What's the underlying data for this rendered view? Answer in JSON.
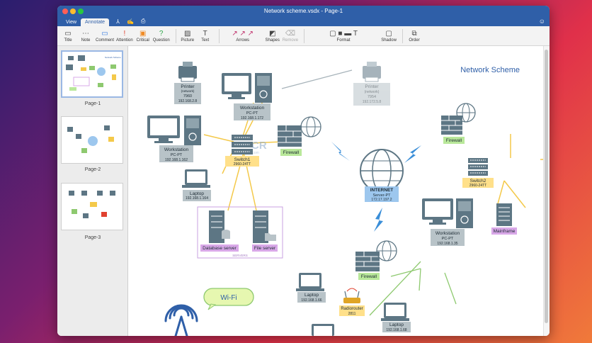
{
  "window": {
    "title": "Network scheme.vsdx - Page-1"
  },
  "tabs": [
    {
      "label": "View",
      "active": false
    },
    {
      "label": "Annotate",
      "active": true
    }
  ],
  "toolbar": {
    "title": "Title",
    "note": "Note",
    "comment": "Comment",
    "attention": "Attention",
    "critical": "Critical",
    "question": "Question",
    "picture": "Picture",
    "text": "Text",
    "arrows": "Arrows",
    "shapes": "Shapes",
    "remove": "Remove",
    "format": "Format",
    "shadow": "Shadow",
    "order": "Order"
  },
  "pages": [
    {
      "label": "Page-1",
      "selected": true
    },
    {
      "label": "Page-2",
      "selected": false
    },
    {
      "label": "Page-3",
      "selected": false
    }
  ],
  "diagram": {
    "title": "Network Scheme",
    "printer1": {
      "name": "Printer",
      "sub": "(network)",
      "model": "7960",
      "ip": "192.168.2.8"
    },
    "printer2": {
      "name": "Printer",
      "sub": "(network)",
      "model": "7954",
      "ip": "192.172.5.8"
    },
    "ws_top": {
      "name": "Workstation",
      "model": "PC-PT",
      "ip": "192.168.1.172"
    },
    "ws_left": {
      "name": "Workstation",
      "model": "PC-PT",
      "ip": "192.168.1.162"
    },
    "ws_right": {
      "name": "Workstation",
      "model": "PC-PT",
      "ip": "192.168.1.35"
    },
    "switch1": {
      "name": "Switch1",
      "model": "2960-24TT"
    },
    "switch2": {
      "name": "Switch2",
      "model": "2960-24TT"
    },
    "firewall": "Firewall",
    "laptop_left": {
      "name": "Laptop",
      "ip": "192.168.1.164"
    },
    "laptop_bl": {
      "name": "Laptop",
      "ip": "192.168.1.66"
    },
    "laptop_br": {
      "name": "Laptop",
      "ip": "192.168.1.68"
    },
    "internet": {
      "name": "INTERNET",
      "model": "Server-PT",
      "ip": "172.17.197.2"
    },
    "db_server": "Database server",
    "file_server": "File server",
    "servers_group": "SERVERS",
    "mainframe": "Mainframe",
    "radiorouter": {
      "name": "Radiorouter",
      "model": "2811"
    },
    "wifi": "Wi-Fi",
    "watermark": "CR",
    "watermark_sub": ".com"
  },
  "colors": {
    "accent": "#2f5fa8",
    "device": "#5d7684",
    "device_label_bg": "#b8c3c8",
    "switch_label_bg": "#ffe08a",
    "firewall_label_bg": "#b9e89a",
    "internet_label_bg": "#9dc7ee",
    "mainframe_label_bg": "#d9a8e8",
    "lines_yellow": "#f4c94a",
    "lines_green": "#8ec96f",
    "lines_grey": "#a7b3ba"
  }
}
